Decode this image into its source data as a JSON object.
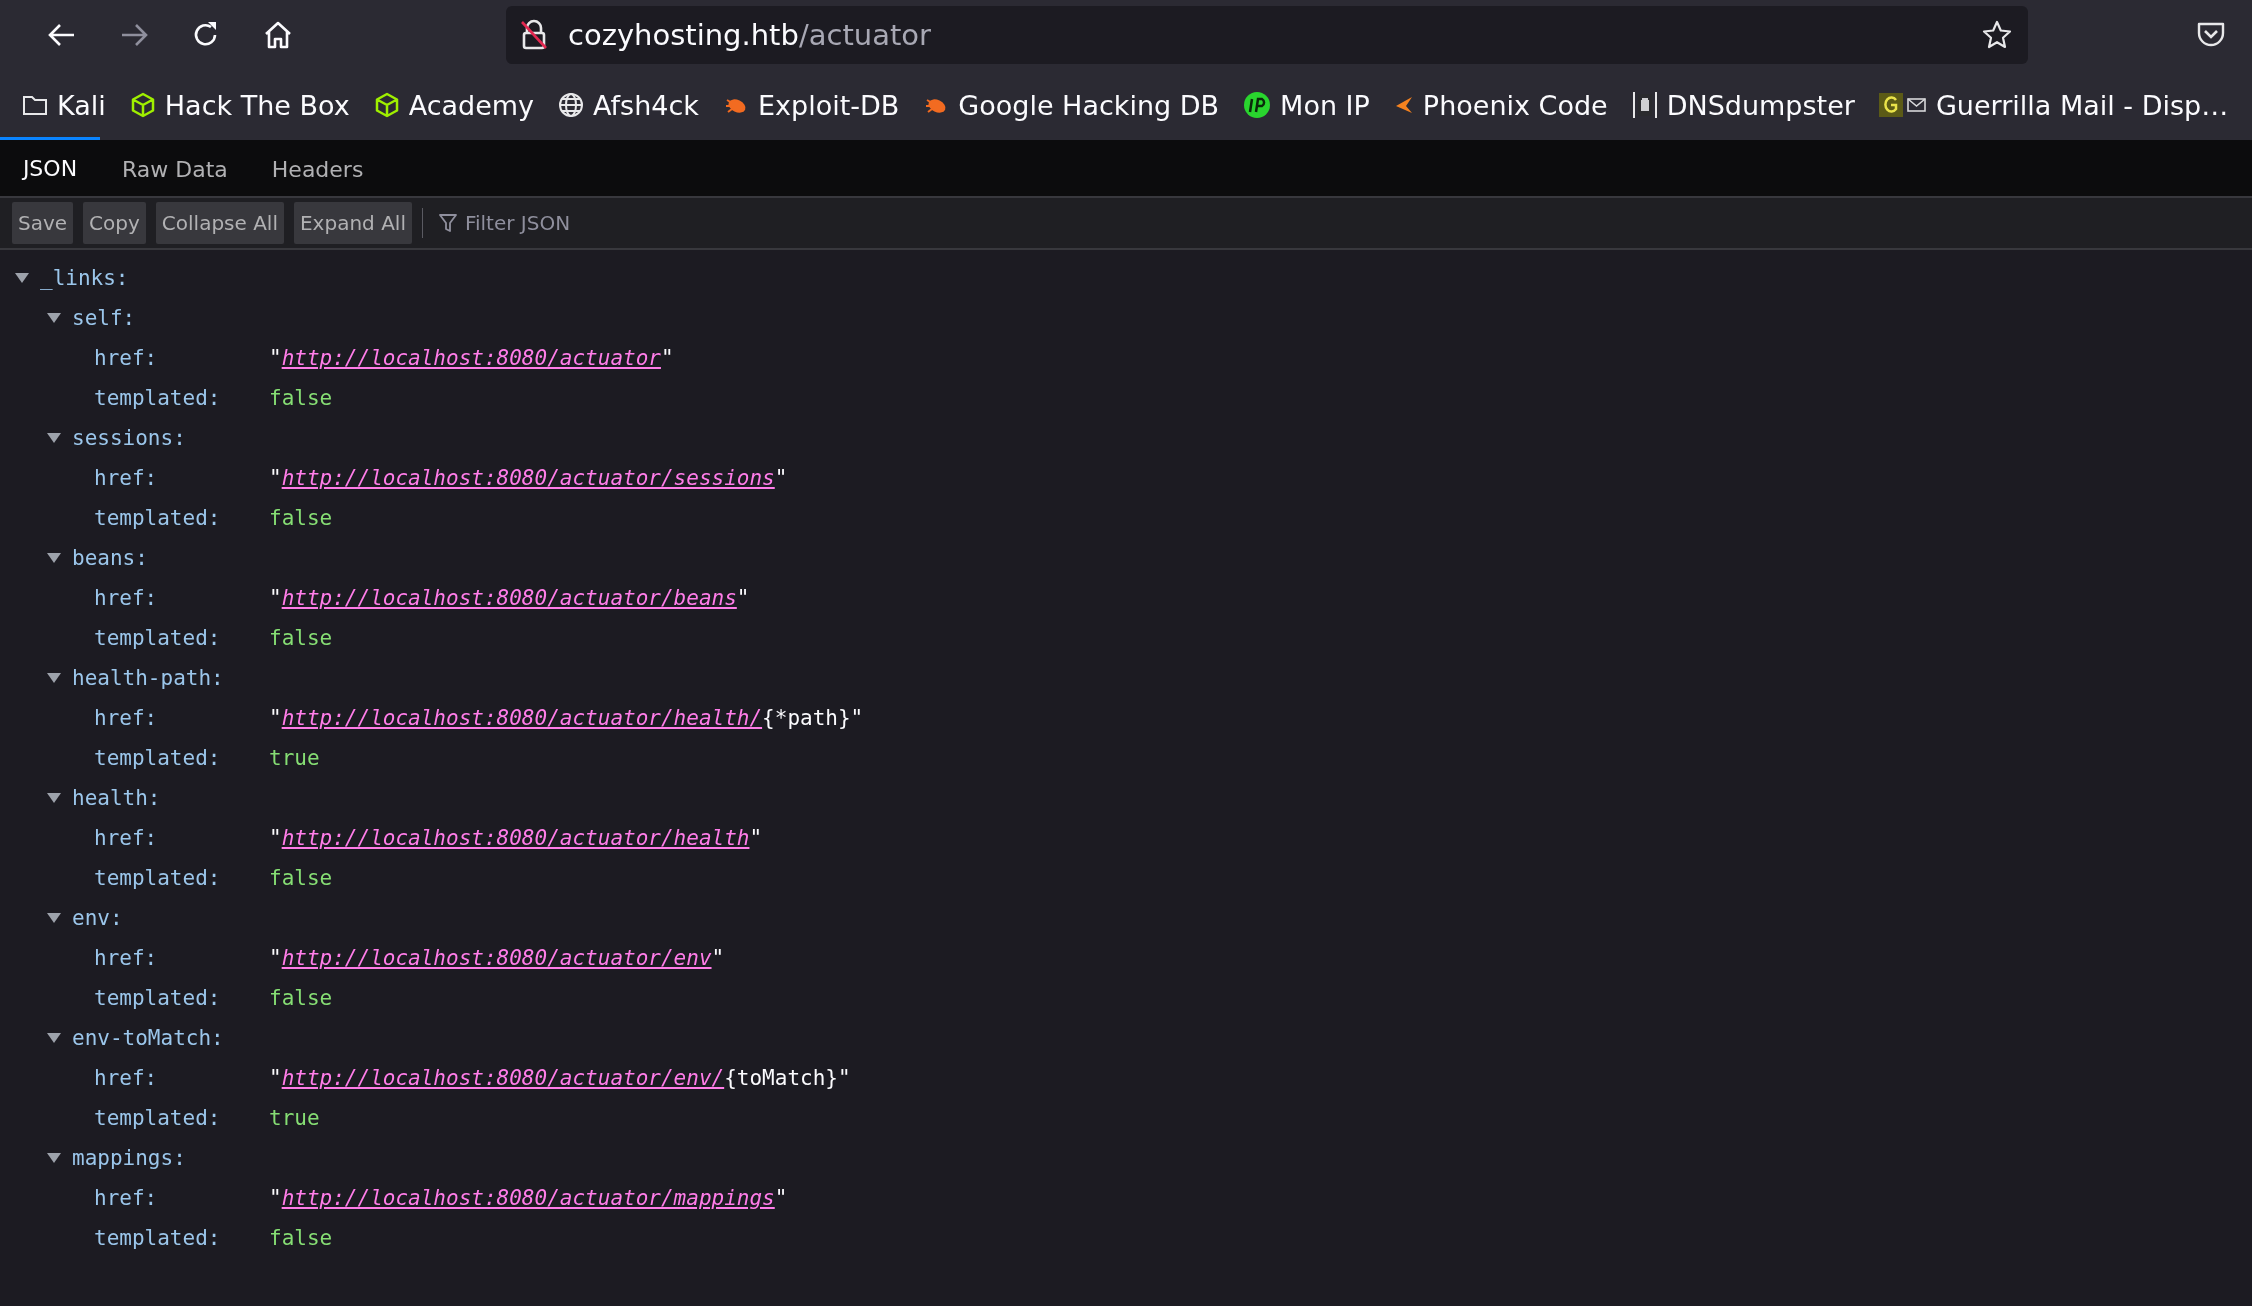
{
  "nav": {
    "back": {
      "disabled": false
    },
    "forward": {
      "disabled": true
    }
  },
  "address_bar": {
    "host": "cozyhosting.htb",
    "path": "/actuator"
  },
  "bookmarks": [
    {
      "label": "Kali",
      "kind": "folder"
    },
    {
      "label": "Hack The Box",
      "kind": "cube"
    },
    {
      "label": "Academy",
      "kind": "cube"
    },
    {
      "label": "Afsh4ck",
      "kind": "globe"
    },
    {
      "label": "Exploit-DB",
      "kind": "bug"
    },
    {
      "label": "Google Hacking DB",
      "kind": "bug"
    },
    {
      "label": "Mon IP",
      "kind": "ip"
    },
    {
      "label": "Phoenix Code",
      "kind": "arrow"
    },
    {
      "label": "DNSdumpster",
      "kind": "clipboard"
    },
    {
      "label": "Guerrilla Mail - Disp…",
      "kind": "mail"
    }
  ],
  "tabs": [
    {
      "label": "JSON",
      "selected": true
    },
    {
      "label": "Raw Data",
      "selected": false
    },
    {
      "label": "Headers",
      "selected": false
    }
  ],
  "toolbar": {
    "buttons": [
      "Save",
      "Copy",
      "Collapse All",
      "Expand All"
    ],
    "filter": {
      "placeholder": "Filter JSON"
    }
  },
  "tree": [
    {
      "key": "_links:",
      "expanded": true,
      "children": [
        {
          "key": "self:",
          "expanded": true,
          "children": [
            {
              "key": "href:",
              "kind": "link",
              "before": "\"",
              "link": "http://localhost:8080/actuator",
              "after": "\""
            },
            {
              "key": "templated:",
              "kind": "boolean",
              "value": "false"
            }
          ]
        },
        {
          "key": "sessions:",
          "expanded": true,
          "children": [
            {
              "key": "href:",
              "kind": "link",
              "before": "\"",
              "link": "http://localhost:8080/actuator/sessions",
              "after": "\""
            },
            {
              "key": "templated:",
              "kind": "boolean",
              "value": "false"
            }
          ]
        },
        {
          "key": "beans:",
          "expanded": true,
          "children": [
            {
              "key": "href:",
              "kind": "link",
              "before": "\"",
              "link": "http://localhost:8080/actuator/beans",
              "after": "\""
            },
            {
              "key": "templated:",
              "kind": "boolean",
              "value": "false"
            }
          ]
        },
        {
          "key": "health-path:",
          "expanded": true,
          "children": [
            {
              "key": "href:",
              "kind": "link",
              "before": "\"",
              "link": "http://localhost:8080/actuator/health/",
              "after": "{*path}\""
            },
            {
              "key": "templated:",
              "kind": "boolean",
              "value": "true"
            }
          ]
        },
        {
          "key": "health:",
          "expanded": true,
          "children": [
            {
              "key": "href:",
              "kind": "link",
              "before": "\"",
              "link": "http://localhost:8080/actuator/health",
              "after": "\""
            },
            {
              "key": "templated:",
              "kind": "boolean",
              "value": "false"
            }
          ]
        },
        {
          "key": "env:",
          "expanded": true,
          "children": [
            {
              "key": "href:",
              "kind": "link",
              "before": "\"",
              "link": "http://localhost:8080/actuator/env",
              "after": "\""
            },
            {
              "key": "templated:",
              "kind": "boolean",
              "value": "false"
            }
          ]
        },
        {
          "key": "env-toMatch:",
          "expanded": true,
          "children": [
            {
              "key": "href:",
              "kind": "link",
              "before": "\"",
              "link": "http://localhost:8080/actuator/env/",
              "after": "{toMatch}\""
            },
            {
              "key": "templated:",
              "kind": "boolean",
              "value": "true"
            }
          ]
        },
        {
          "key": "mappings:",
          "expanded": true,
          "children": [
            {
              "key": "href:",
              "kind": "link",
              "before": "\"",
              "link": "http://localhost:8080/actuator/mappings",
              "after": "\""
            },
            {
              "key": "templated:",
              "kind": "boolean",
              "value": "false"
            }
          ]
        }
      ]
    }
  ]
}
